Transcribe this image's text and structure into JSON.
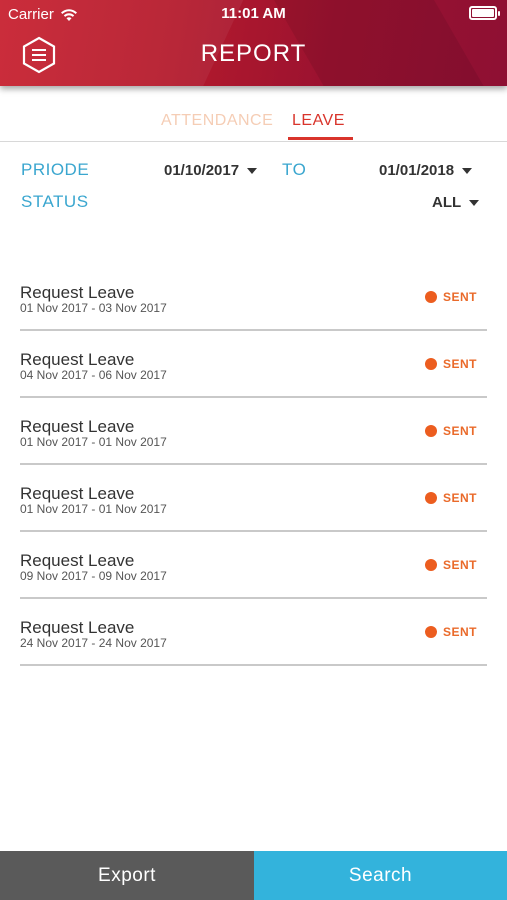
{
  "status_bar": {
    "carrier": "Carrier",
    "time": "11:01 AM",
    "icons": [
      "wifi-icon",
      "battery-icon"
    ]
  },
  "header": {
    "title": "REPORT",
    "menu_icon": "hexagon-menu-icon"
  },
  "tabs": [
    {
      "label": "ATTENDANCE",
      "active": false
    },
    {
      "label": "LEAVE",
      "active": true
    }
  ],
  "filters": {
    "period_label": "PRIODE",
    "from_date": "01/10/2017",
    "to_label": "TO",
    "to_date": "01/01/2018",
    "status_label": "STATUS",
    "status_value": "ALL"
  },
  "leave_items": [
    {
      "title": "Request Leave",
      "range": "01 Nov 2017 - 03 Nov 2017",
      "status": "SENT"
    },
    {
      "title": "Request Leave",
      "range": "04 Nov 2017 - 06 Nov 2017",
      "status": "SENT"
    },
    {
      "title": "Request Leave",
      "range": "01 Nov 2017 - 01 Nov 2017",
      "status": "SENT"
    },
    {
      "title": "Request Leave",
      "range": "01 Nov 2017 - 01 Nov 2017",
      "status": "SENT"
    },
    {
      "title": "Request Leave",
      "range": "09 Nov 2017 - 09 Nov 2017",
      "status": "SENT"
    },
    {
      "title": "Request Leave",
      "range": "24 Nov 2017 - 24 Nov 2017",
      "status": "SENT"
    }
  ],
  "footer": {
    "export_label": "Export",
    "search_label": "Search"
  },
  "colors": {
    "header_red": "#b41a2c",
    "tab_active": "#d9342b",
    "tab_inactive": "#f5cdb5",
    "filter_label": "#3aa6cf",
    "status_sent": "#ec5d1f",
    "export_bg": "#5a5a5a",
    "search_bg": "#33b3dc"
  }
}
